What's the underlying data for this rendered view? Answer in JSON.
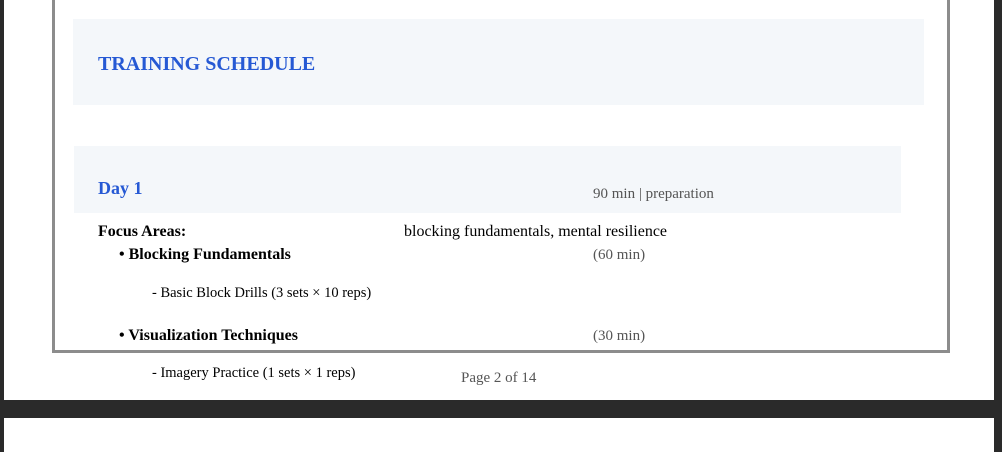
{
  "document": {
    "title": "TRAINING SCHEDULE",
    "day": {
      "title": "Day 1",
      "meta": "90 min | preparation",
      "focus_label": "Focus Areas:",
      "focus_value": "blocking fundamentals, mental resilience",
      "exercises": [
        {
          "name": "• Blocking Fundamentals",
          "duration": "(60 min)",
          "drill": "- Basic Block Drills (3 sets × 10 reps)"
        },
        {
          "name": "• Visualization Techniques",
          "duration": "(30 min)",
          "drill": "- Imagery Practice (1 sets × 1 reps)"
        }
      ]
    },
    "page_number": "Page 2 of 14"
  }
}
